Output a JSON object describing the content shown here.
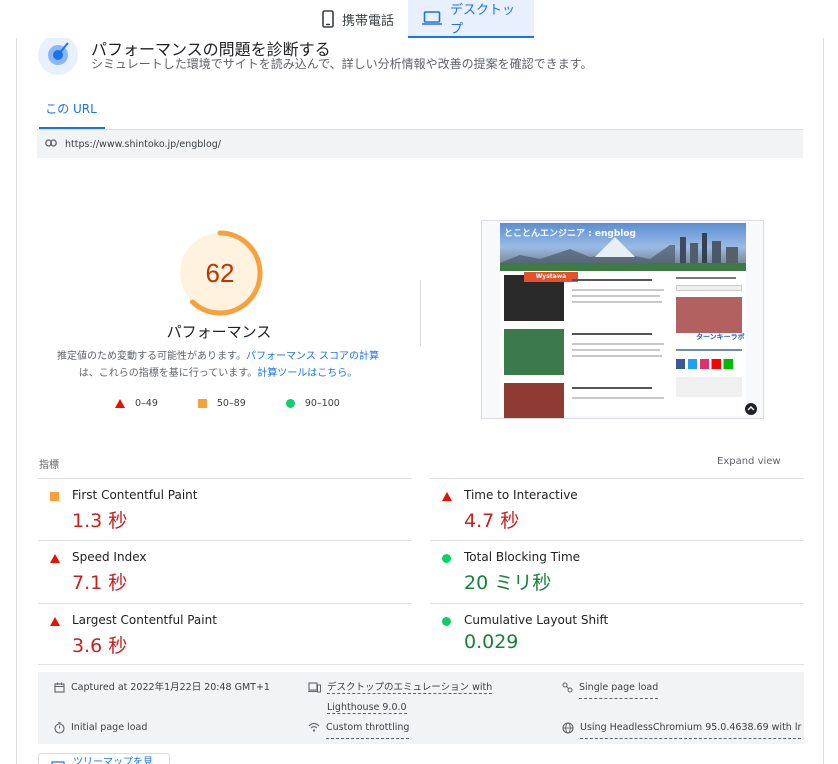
{
  "device_tabs": {
    "mobile_label": "携帯電話",
    "desktop_label": "デスクトップ"
  },
  "diagnose": {
    "title": "パフォーマンスの問題を診断する",
    "subtitle": "シミュレートした環境でサイトを読み込んで、詳しい分析情報や改善の提案を確認できます。"
  },
  "url_tab": {
    "label": "この URL"
  },
  "url_bar": {
    "url": "https://www.shintoko.jp/engblog/"
  },
  "score": {
    "value": "62",
    "fraction": 0.62,
    "label": "パフォーマンス",
    "note_part1": "推定値のため変動する可能性があります。",
    "note_link1": "パフォーマンス スコアの計算",
    "note_part2": "は、これらの指標を基に行っています。",
    "note_link2": "計算ツールはこちら。"
  },
  "legend": [
    {
      "range": "0–49",
      "shape": "triangle",
      "color": "#eb0f00"
    },
    {
      "range": "50–89",
      "shape": "square",
      "color": "#f7a13b"
    },
    {
      "range": "90–100",
      "shape": "circle",
      "color": "#0cce6b"
    }
  ],
  "thumbnail": {
    "site_title": "とことんエンジニア : engblog",
    "banner_text": "Wystawa",
    "side_text": "ターンキーラボ"
  },
  "metrics_section": {
    "label": "指標",
    "expand_label": "Expand view"
  },
  "metrics": [
    {
      "title": "First Contentful Paint",
      "value": "1.3 秒",
      "status": "average",
      "color": "#c5221f"
    },
    {
      "title": "Time to Interactive",
      "value": "4.7 秒",
      "status": "fail",
      "color": "#c5221f"
    },
    {
      "title": "Speed Index",
      "value": "7.1 秒",
      "status": "fail",
      "color": "#c5221f"
    },
    {
      "title": "Total Blocking Time",
      "value": "20 ミリ秒",
      "status": "pass",
      "color": "#188038"
    },
    {
      "title": "Largest Contentful Paint",
      "value": "3.6 秒",
      "status": "fail",
      "color": "#c5221f"
    },
    {
      "title": "Cumulative Layout Shift",
      "value": "0.029",
      "status": "pass",
      "color": "#188038"
    }
  ],
  "info": {
    "captured": "Captured at 2022年1月22日 20:48 GMT+1",
    "emulation_line1": "デスクトップのエミュレーション with",
    "emulation_line2": "Lighthouse 9.0.0",
    "single_page": "Single page load",
    "initial_load": "Initial page load",
    "throttling": "Custom throttling",
    "browser": "Using HeadlessChromium 95.0.4638.69 with lr"
  },
  "treemap": {
    "label": "ツリーマップを見る"
  }
}
